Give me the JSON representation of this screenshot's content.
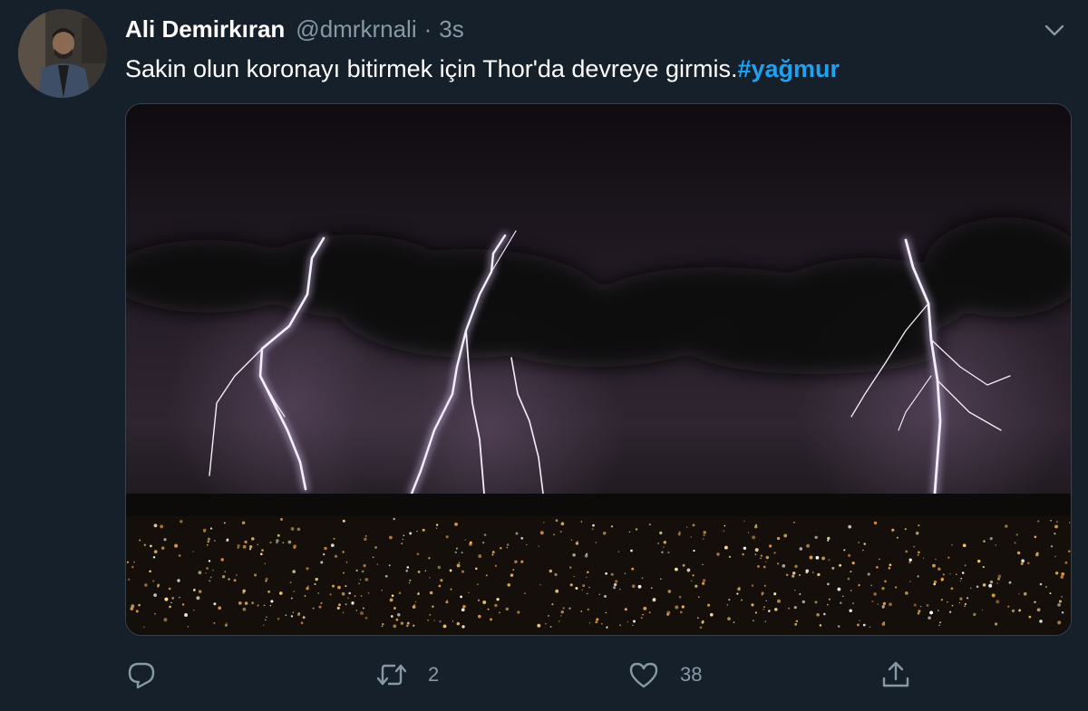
{
  "tweet": {
    "author_name": "Ali Demirkıran",
    "handle": "@dmrkrnali",
    "separator": "·",
    "time": "3s",
    "text": "Sakin olun koronayı bitirmek için Thor'da devreye girmis.",
    "hashtag": "#yağmur"
  },
  "actions": {
    "reply": {
      "icon": "reply-icon",
      "count": ""
    },
    "retweet": {
      "icon": "retweet-icon",
      "count": "2"
    },
    "like": {
      "icon": "heart-icon",
      "count": "38"
    },
    "share": {
      "icon": "share-icon",
      "count": ""
    }
  },
  "theme": {
    "background": "#15202b",
    "secondary_text": "#8899a6",
    "link": "#1da1f2",
    "border": "#38444d"
  }
}
